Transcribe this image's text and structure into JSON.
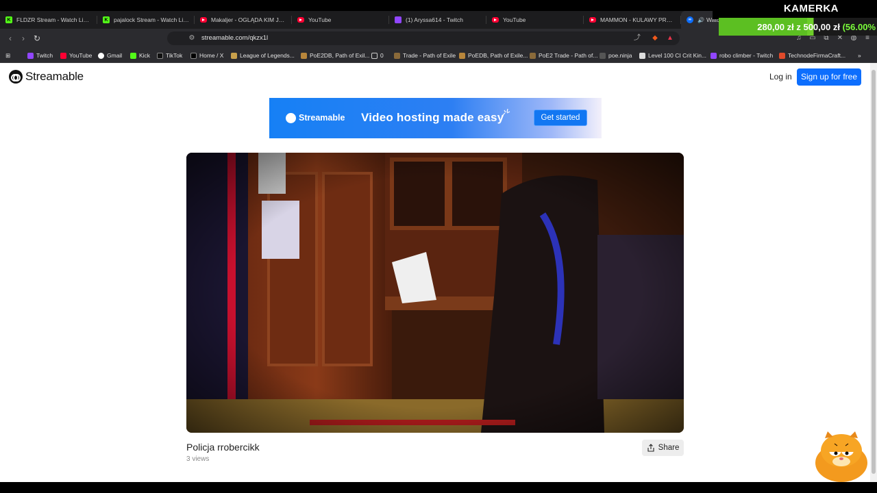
{
  "overlay": {
    "title": "KAMERKA",
    "donation": "280,00 zł z 500,00 zł",
    "donation_pct": "(56.00%",
    "progress_fraction": 0.56
  },
  "tabs": [
    {
      "label": "FLDZR Stream - Watch Live on",
      "icon": "kick"
    },
    {
      "label": "pajalock Stream - Watch Live o",
      "icon": "kick"
    },
    {
      "label": "Makaljer - OGLĄDA KIM JEST",
      "icon": "youtube"
    },
    {
      "label": "YouTube",
      "icon": "youtube"
    },
    {
      "label": "(1) Aryssa614 - Twitch",
      "icon": "twitch"
    },
    {
      "label": "YouTube",
      "icon": "youtube"
    },
    {
      "label": "MAMMON - KULAWY PRAWIC",
      "icon": "youtube"
    },
    {
      "label": "Watc",
      "icon": "streamable"
    }
  ],
  "address": {
    "url": "streamable.com/qkzx1l"
  },
  "bookmarks": [
    "Twitch",
    "YouTube",
    "Gmail",
    "Kick",
    "TikTok",
    "Home / X",
    "League of Legends...",
    "PoE2DB, Path of Exil...",
    "0",
    "Trade - Path of Exile",
    "PoEDB, Path of Exile...",
    "PoE2 Trade - Path of...",
    "poe.ninja",
    "Level 100 CI Crit Kin...",
    "robo climber - Twitch",
    "TechnodeFirmaCraft..."
  ],
  "header": {
    "logo": "Streamable",
    "login": "Log in",
    "signup": "Sign up for free"
  },
  "banner": {
    "brand": "Streamable",
    "tagline": "Video hosting made easy",
    "cta": "Get started"
  },
  "video": {
    "title": "Policja rrobercikk",
    "views": "3 views",
    "share": "Share"
  },
  "colors": {
    "accent": "#0d6efd",
    "overlay_green": "#6fcf2a"
  }
}
